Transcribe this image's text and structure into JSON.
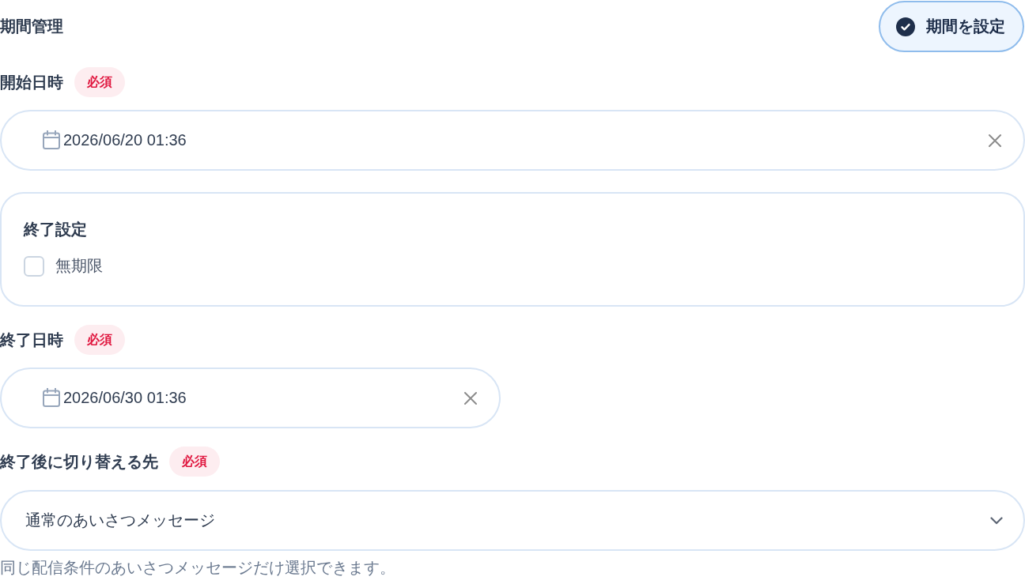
{
  "header": {
    "title": "期間管理",
    "button": {
      "label": "期間を設定",
      "active": true
    }
  },
  "start": {
    "label": "開始日時",
    "badge": "必須",
    "value": "2026/06/20 01:36"
  },
  "end_settings": {
    "title": "終了設定",
    "checkbox": {
      "label": "無期限",
      "checked": false
    }
  },
  "end": {
    "label": "終了日時",
    "badge": "必須",
    "value": "2026/06/30 01:36"
  },
  "switch_target": {
    "label": "終了後に切り替える先",
    "badge": "必須",
    "value": "通常のあいさつメッセージ",
    "help": "同じ配信条件のあいさつメッセージだけ選択できます。"
  }
}
